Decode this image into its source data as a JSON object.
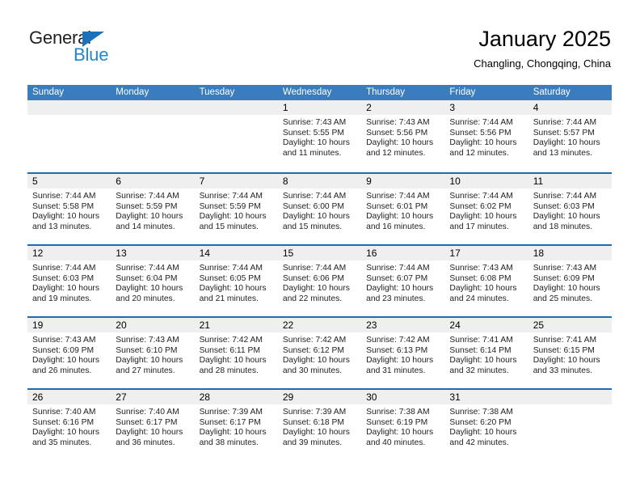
{
  "brand": {
    "logo_text_1": "General",
    "logo_text_2": "Blue",
    "triangle_icon": "triangle-icon",
    "accent_blue": "#2087d0",
    "dark_text": "#231f20"
  },
  "header": {
    "month_title": "January 2025",
    "location": "Changling, Chongqing, China"
  },
  "calendar": {
    "header_bg": "#3a7cbe",
    "row_divider": "#1b6cb0",
    "day_band_bg": "#efefef",
    "day_names": [
      "Sunday",
      "Monday",
      "Tuesday",
      "Wednesday",
      "Thursday",
      "Friday",
      "Saturday"
    ],
    "weeks": [
      [
        {
          "day": "",
          "empty": true,
          "sunrise": "",
          "sunset": "",
          "daylight_1": "",
          "daylight_2": ""
        },
        {
          "day": "",
          "empty": true,
          "sunrise": "",
          "sunset": "",
          "daylight_1": "",
          "daylight_2": ""
        },
        {
          "day": "",
          "empty": true,
          "sunrise": "",
          "sunset": "",
          "daylight_1": "",
          "daylight_2": ""
        },
        {
          "day": "1",
          "empty": false,
          "sunrise": "Sunrise: 7:43 AM",
          "sunset": "Sunset: 5:55 PM",
          "daylight_1": "Daylight: 10 hours",
          "daylight_2": "and 11 minutes."
        },
        {
          "day": "2",
          "empty": false,
          "sunrise": "Sunrise: 7:43 AM",
          "sunset": "Sunset: 5:56 PM",
          "daylight_1": "Daylight: 10 hours",
          "daylight_2": "and 12 minutes."
        },
        {
          "day": "3",
          "empty": false,
          "sunrise": "Sunrise: 7:44 AM",
          "sunset": "Sunset: 5:56 PM",
          "daylight_1": "Daylight: 10 hours",
          "daylight_2": "and 12 minutes."
        },
        {
          "day": "4",
          "empty": false,
          "sunrise": "Sunrise: 7:44 AM",
          "sunset": "Sunset: 5:57 PM",
          "daylight_1": "Daylight: 10 hours",
          "daylight_2": "and 13 minutes."
        }
      ],
      [
        {
          "day": "5",
          "empty": false,
          "sunrise": "Sunrise: 7:44 AM",
          "sunset": "Sunset: 5:58 PM",
          "daylight_1": "Daylight: 10 hours",
          "daylight_2": "and 13 minutes."
        },
        {
          "day": "6",
          "empty": false,
          "sunrise": "Sunrise: 7:44 AM",
          "sunset": "Sunset: 5:59 PM",
          "daylight_1": "Daylight: 10 hours",
          "daylight_2": "and 14 minutes."
        },
        {
          "day": "7",
          "empty": false,
          "sunrise": "Sunrise: 7:44 AM",
          "sunset": "Sunset: 5:59 PM",
          "daylight_1": "Daylight: 10 hours",
          "daylight_2": "and 15 minutes."
        },
        {
          "day": "8",
          "empty": false,
          "sunrise": "Sunrise: 7:44 AM",
          "sunset": "Sunset: 6:00 PM",
          "daylight_1": "Daylight: 10 hours",
          "daylight_2": "and 15 minutes."
        },
        {
          "day": "9",
          "empty": false,
          "sunrise": "Sunrise: 7:44 AM",
          "sunset": "Sunset: 6:01 PM",
          "daylight_1": "Daylight: 10 hours",
          "daylight_2": "and 16 minutes."
        },
        {
          "day": "10",
          "empty": false,
          "sunrise": "Sunrise: 7:44 AM",
          "sunset": "Sunset: 6:02 PM",
          "daylight_1": "Daylight: 10 hours",
          "daylight_2": "and 17 minutes."
        },
        {
          "day": "11",
          "empty": false,
          "sunrise": "Sunrise: 7:44 AM",
          "sunset": "Sunset: 6:03 PM",
          "daylight_1": "Daylight: 10 hours",
          "daylight_2": "and 18 minutes."
        }
      ],
      [
        {
          "day": "12",
          "empty": false,
          "sunrise": "Sunrise: 7:44 AM",
          "sunset": "Sunset: 6:03 PM",
          "daylight_1": "Daylight: 10 hours",
          "daylight_2": "and 19 minutes."
        },
        {
          "day": "13",
          "empty": false,
          "sunrise": "Sunrise: 7:44 AM",
          "sunset": "Sunset: 6:04 PM",
          "daylight_1": "Daylight: 10 hours",
          "daylight_2": "and 20 minutes."
        },
        {
          "day": "14",
          "empty": false,
          "sunrise": "Sunrise: 7:44 AM",
          "sunset": "Sunset: 6:05 PM",
          "daylight_1": "Daylight: 10 hours",
          "daylight_2": "and 21 minutes."
        },
        {
          "day": "15",
          "empty": false,
          "sunrise": "Sunrise: 7:44 AM",
          "sunset": "Sunset: 6:06 PM",
          "daylight_1": "Daylight: 10 hours",
          "daylight_2": "and 22 minutes."
        },
        {
          "day": "16",
          "empty": false,
          "sunrise": "Sunrise: 7:44 AM",
          "sunset": "Sunset: 6:07 PM",
          "daylight_1": "Daylight: 10 hours",
          "daylight_2": "and 23 minutes."
        },
        {
          "day": "17",
          "empty": false,
          "sunrise": "Sunrise: 7:43 AM",
          "sunset": "Sunset: 6:08 PM",
          "daylight_1": "Daylight: 10 hours",
          "daylight_2": "and 24 minutes."
        },
        {
          "day": "18",
          "empty": false,
          "sunrise": "Sunrise: 7:43 AM",
          "sunset": "Sunset: 6:09 PM",
          "daylight_1": "Daylight: 10 hours",
          "daylight_2": "and 25 minutes."
        }
      ],
      [
        {
          "day": "19",
          "empty": false,
          "sunrise": "Sunrise: 7:43 AM",
          "sunset": "Sunset: 6:09 PM",
          "daylight_1": "Daylight: 10 hours",
          "daylight_2": "and 26 minutes."
        },
        {
          "day": "20",
          "empty": false,
          "sunrise": "Sunrise: 7:43 AM",
          "sunset": "Sunset: 6:10 PM",
          "daylight_1": "Daylight: 10 hours",
          "daylight_2": "and 27 minutes."
        },
        {
          "day": "21",
          "empty": false,
          "sunrise": "Sunrise: 7:42 AM",
          "sunset": "Sunset: 6:11 PM",
          "daylight_1": "Daylight: 10 hours",
          "daylight_2": "and 28 minutes."
        },
        {
          "day": "22",
          "empty": false,
          "sunrise": "Sunrise: 7:42 AM",
          "sunset": "Sunset: 6:12 PM",
          "daylight_1": "Daylight: 10 hours",
          "daylight_2": "and 30 minutes."
        },
        {
          "day": "23",
          "empty": false,
          "sunrise": "Sunrise: 7:42 AM",
          "sunset": "Sunset: 6:13 PM",
          "daylight_1": "Daylight: 10 hours",
          "daylight_2": "and 31 minutes."
        },
        {
          "day": "24",
          "empty": false,
          "sunrise": "Sunrise: 7:41 AM",
          "sunset": "Sunset: 6:14 PM",
          "daylight_1": "Daylight: 10 hours",
          "daylight_2": "and 32 minutes."
        },
        {
          "day": "25",
          "empty": false,
          "sunrise": "Sunrise: 7:41 AM",
          "sunset": "Sunset: 6:15 PM",
          "daylight_1": "Daylight: 10 hours",
          "daylight_2": "and 33 minutes."
        }
      ],
      [
        {
          "day": "26",
          "empty": false,
          "sunrise": "Sunrise: 7:40 AM",
          "sunset": "Sunset: 6:16 PM",
          "daylight_1": "Daylight: 10 hours",
          "daylight_2": "and 35 minutes."
        },
        {
          "day": "27",
          "empty": false,
          "sunrise": "Sunrise: 7:40 AM",
          "sunset": "Sunset: 6:17 PM",
          "daylight_1": "Daylight: 10 hours",
          "daylight_2": "and 36 minutes."
        },
        {
          "day": "28",
          "empty": false,
          "sunrise": "Sunrise: 7:39 AM",
          "sunset": "Sunset: 6:17 PM",
          "daylight_1": "Daylight: 10 hours",
          "daylight_2": "and 38 minutes."
        },
        {
          "day": "29",
          "empty": false,
          "sunrise": "Sunrise: 7:39 AM",
          "sunset": "Sunset: 6:18 PM",
          "daylight_1": "Daylight: 10 hours",
          "daylight_2": "and 39 minutes."
        },
        {
          "day": "30",
          "empty": false,
          "sunrise": "Sunrise: 7:38 AM",
          "sunset": "Sunset: 6:19 PM",
          "daylight_1": "Daylight: 10 hours",
          "daylight_2": "and 40 minutes."
        },
        {
          "day": "31",
          "empty": false,
          "sunrise": "Sunrise: 7:38 AM",
          "sunset": "Sunset: 6:20 PM",
          "daylight_1": "Daylight: 10 hours",
          "daylight_2": "and 42 minutes."
        },
        {
          "day": "",
          "empty": true,
          "sunrise": "",
          "sunset": "",
          "daylight_1": "",
          "daylight_2": ""
        }
      ]
    ]
  }
}
